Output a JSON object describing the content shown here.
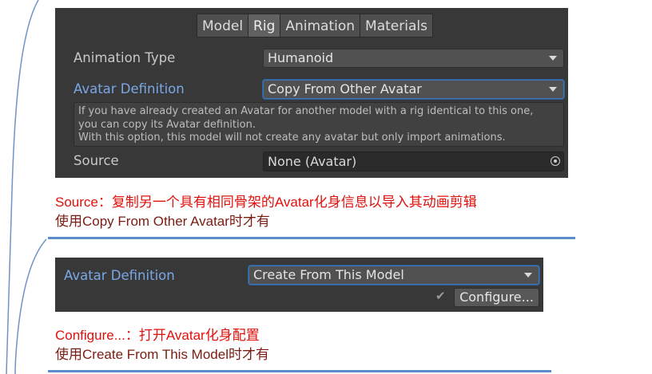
{
  "inspector_top": {
    "tabs": [
      "Model",
      "Rig",
      "Animation",
      "Materials"
    ],
    "active_tab": "Rig",
    "animation_type": {
      "label": "Animation Type",
      "value": "Humanoid"
    },
    "avatar_definition": {
      "label": "Avatar Definition",
      "value": "Copy From Other Avatar"
    },
    "help_lines": [
      "If you have already created an Avatar for another model with a rig identical to this one,",
      "you can copy its Avatar definition.",
      "With this option, this model will not create any avatar but only import animations."
    ],
    "source": {
      "label": "Source",
      "value": "None (Avatar)"
    }
  },
  "note_top": {
    "line1_label": "Source",
    "line1_sep": "：",
    "line1_text": "复制另一个具有相同骨架的Avatar化身信息以导入其动画剪辑",
    "line2": "使用Copy From Other Avatar时才有"
  },
  "inspector_bottom": {
    "avatar_definition": {
      "label": "Avatar Definition",
      "value": "Create From This Model"
    },
    "check": "✔",
    "configure_button": "Configure..."
  },
  "note_bottom": {
    "line1_label": "Configure...",
    "line1_sep": "：",
    "line1_text": "打开Avatar化身配置",
    "line2": "使用Create From This Model时才有"
  },
  "colors": {
    "panel_bg": "#383838",
    "blue_label": "#7ba7e6",
    "note_red": "#e0110c",
    "note_brown": "#7a1c12",
    "rule_blue": "#5b8ccc",
    "curve_blue": "#6f93c8"
  },
  "icons": [
    "dropdown-arrow-icon",
    "object-picker-icon",
    "checkmark-icon"
  ]
}
